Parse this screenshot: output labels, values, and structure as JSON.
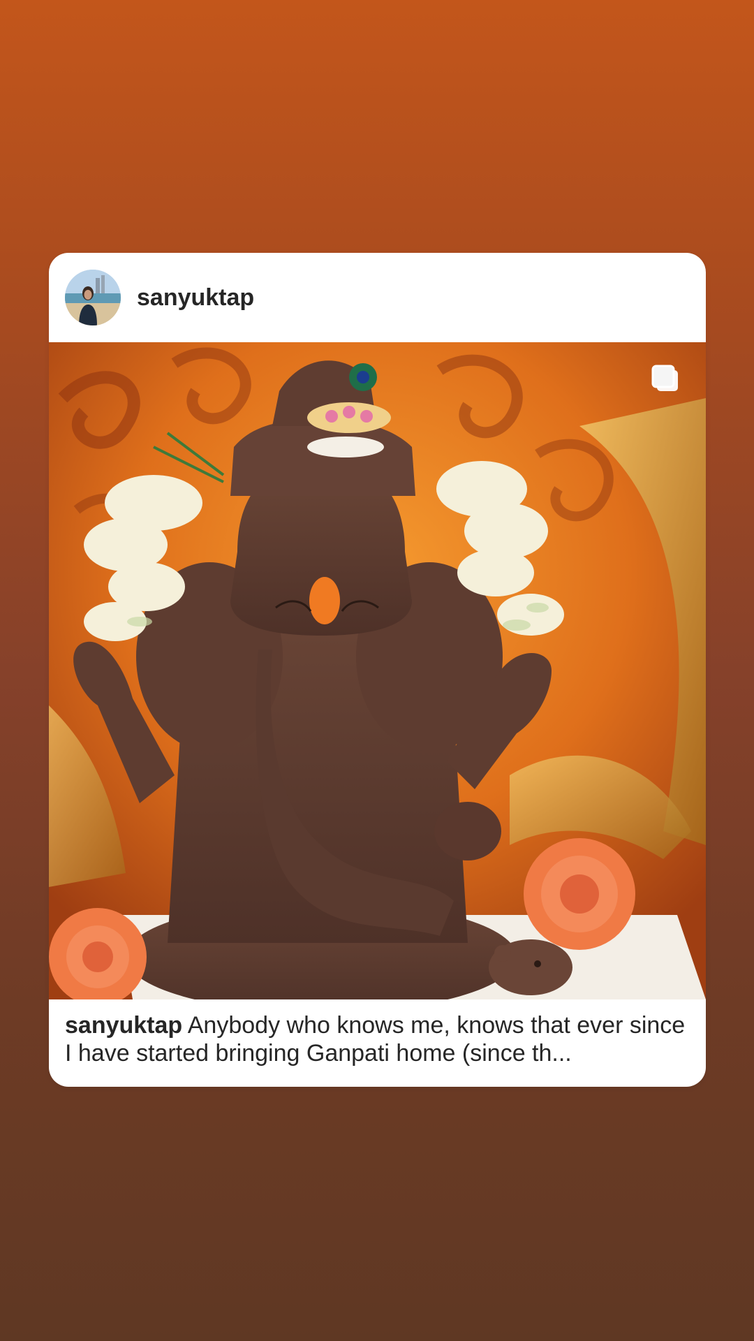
{
  "post": {
    "username": "sanyuktap",
    "caption_username": "sanyuktap",
    "caption_text": " Anybody who knows me, knows that ever since I have started bringing Ganpati home (since th..."
  },
  "icons": {
    "avatar": "profile-photo",
    "carousel": "multiple-photos-icon"
  },
  "colors": {
    "background_top": "#c3561b",
    "background_bottom": "#5f3823",
    "card": "#ffffff",
    "text": "#262626"
  }
}
